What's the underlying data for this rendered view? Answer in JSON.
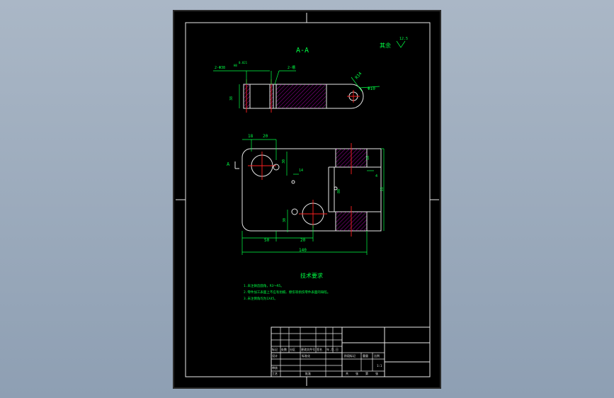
{
  "drawing": {
    "section_label": "A-A",
    "section_marker": "A",
    "roughness_label": "其余",
    "roughness_value": "12.5",
    "dims": {
      "two_holes": "2-Φ38",
      "fit": "H8",
      "tolerance": "0.021",
      "two_slots": "2-槽",
      "r14": "R14",
      "phi10": "Φ10",
      "thick_top": "38",
      "d18": "18",
      "d20a": "20",
      "d30": "30",
      "d14": "14",
      "d4": "4",
      "d18b": "18",
      "d80": "80",
      "d22": "22",
      "d30b": "30",
      "d30c": "30",
      "d50": "50",
      "d20b": "20",
      "d140": "140"
    },
    "notes_title": "技术要求",
    "notes": [
      "1.未注铸造圆角，R3～R5。",
      "2.零件加工表面上不应有划痕、擦伤等损伤零件表面的缺陷。",
      "3.未注倒角均为1X45。"
    ]
  },
  "title_block": {
    "row_labels": [
      "标记",
      "处数",
      "分区",
      "更改文件号",
      "签名",
      "年.月.日"
    ],
    "design": "设计",
    "standard": "标准化",
    "audit": "审核",
    "process": "工艺",
    "approve": "批准",
    "stage_labels": [
      "阶段标记",
      "重量",
      "比例"
    ],
    "scale": "1:1",
    "sheet_labels": [
      "共",
      "张",
      "第",
      "张"
    ]
  }
}
